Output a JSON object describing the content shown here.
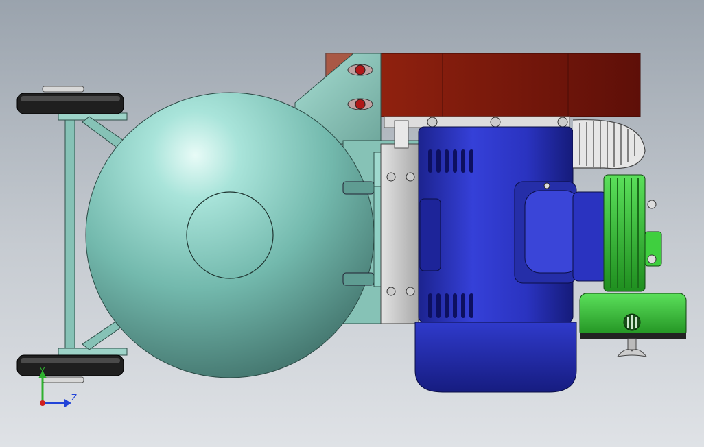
{
  "view": {
    "triad": {
      "y_label": "Y",
      "z_label": "Z",
      "y_color": "#2fb02f",
      "z_color": "#2244d8",
      "origin_color": "#d02020"
    },
    "colors": {
      "tank": "#7fd0c4",
      "frame": "#8cc9bd",
      "motor": "#2b35c8",
      "cover": "#8b1a0e",
      "pump": "#3fcf3f",
      "wheel": "#222222"
    },
    "parts": [
      "wheel-top",
      "wheel-bottom",
      "wheel-axle",
      "air-tank",
      "tank-flange",
      "mount-plate",
      "electric-motor",
      "motor-end-cap",
      "belt-guard",
      "air-pump-cylinder",
      "intake-filter",
      "wing-nut",
      "delivery-hose"
    ]
  }
}
